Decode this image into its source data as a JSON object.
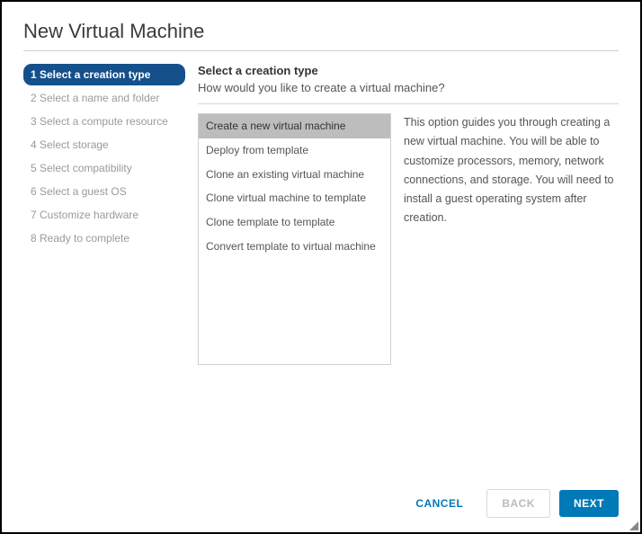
{
  "title": "New Virtual Machine",
  "steps": [
    {
      "label": "1 Select a creation type",
      "active": true
    },
    {
      "label": "2 Select a name and folder",
      "active": false
    },
    {
      "label": "3 Select a compute resource",
      "active": false
    },
    {
      "label": "4 Select storage",
      "active": false
    },
    {
      "label": "5 Select compatibility",
      "active": false
    },
    {
      "label": "6 Select a guest OS",
      "active": false
    },
    {
      "label": "7 Customize hardware",
      "active": false
    },
    {
      "label": "8 Ready to complete",
      "active": false
    }
  ],
  "main": {
    "heading": "Select a creation type",
    "subheading": "How would you like to create a virtual machine?",
    "options": [
      {
        "label": "Create a new virtual machine",
        "selected": true
      },
      {
        "label": "Deploy from template",
        "selected": false
      },
      {
        "label": "Clone an existing virtual machine",
        "selected": false
      },
      {
        "label": "Clone virtual machine to template",
        "selected": false
      },
      {
        "label": "Clone template to template",
        "selected": false
      },
      {
        "label": "Convert template to virtual machine",
        "selected": false
      }
    ],
    "description": "This option guides you through creating a new virtual machine. You will be able to customize processors, memory, network connections, and storage. You will need to install a guest operating system after creation."
  },
  "footer": {
    "cancel": "CANCEL",
    "back": "BACK",
    "next": "NEXT"
  }
}
